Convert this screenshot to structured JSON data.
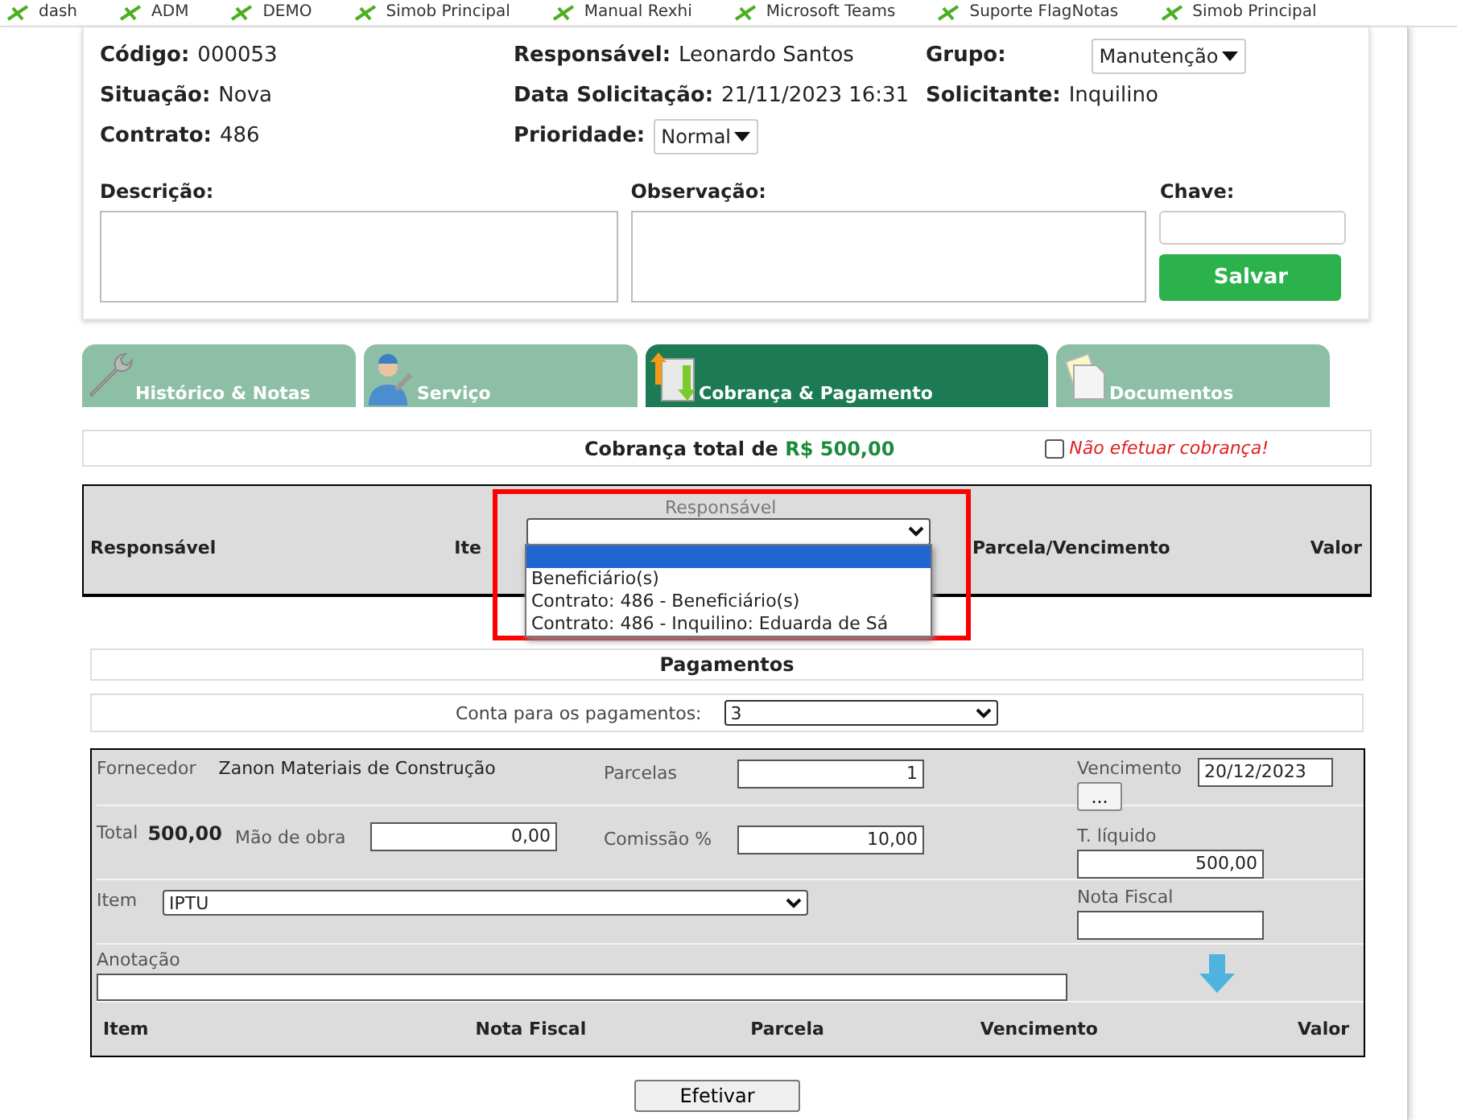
{
  "bookmarks": [
    {
      "label": "dash"
    },
    {
      "label": "ADM"
    },
    {
      "label": "DEMO"
    },
    {
      "label": "Simob Principal"
    },
    {
      "label": "Manual Rexhi"
    },
    {
      "label": "Microsoft Teams"
    },
    {
      "label": "Suporte FlagNotas"
    },
    {
      "label": "Simob Principal"
    }
  ],
  "info": [
    {
      "kind": "text",
      "label": "Código:",
      "value": "000053"
    },
    {
      "kind": "text",
      "label": "Responsável:",
      "value": "Leonardo Santos"
    },
    {
      "kind": "select",
      "label": "Grupo:",
      "value": "Manutenção"
    },
    {
      "kind": "text",
      "label": "Situação:",
      "value": "Nova"
    },
    {
      "kind": "text",
      "label": "Data Solicitação:",
      "value": "21/11/2023 16:31"
    },
    {
      "kind": "text",
      "label": "Solicitante:",
      "value": "Inquilino"
    },
    {
      "kind": "text",
      "label": "Contrato:",
      "value": "486"
    },
    {
      "kind": "select",
      "label": "Prioridade:",
      "value": "Normal"
    }
  ],
  "notes": {
    "description": "Descrição:",
    "observation": "Observação:",
    "key": "Chave:",
    "save": "Salvar"
  },
  "tabs": [
    {
      "label": "Histórico & Notas",
      "selected": false
    },
    {
      "label": "Serviço",
      "selected": false
    },
    {
      "label": "Cobrança & Pagamento",
      "selected": true
    },
    {
      "label": "Documentos",
      "selected": false
    }
  ],
  "charge": {
    "label": "Cobrança total de",
    "amount": "R$ 500,00",
    "no_charge": {
      "label": "Não efetuar cobrança!",
      "checked": false
    }
  },
  "responsible_table": {
    "columns": [
      "Responsável",
      "Ite",
      "Parcela/Vencimento",
      "Valor"
    ],
    "select": {
      "label": "Responsável",
      "expanded": true,
      "options": [
        {
          "selected": true
        },
        {
          "label": "Beneficiário(s)",
          "selected": false
        },
        {
          "label": "Contrato: 486 - Beneficiário(s)",
          "selected": false
        },
        {
          "label": "Contrato: 486 - Inquilino: Eduarda de Sá",
          "selected": false
        }
      ]
    }
  },
  "payments": {
    "title": "Pagamentos",
    "account_label": "Conta para os pagamentos:",
    "account_value": "3"
  },
  "form": {
    "supplier_label": "Fornecedor",
    "supplier": "Zanon Materiais de Construção",
    "installments_label": "Parcelas",
    "installments": "1",
    "due_label": "Vencimento",
    "due": "20/12/2023",
    "due_button": "...",
    "total_label": "Total",
    "total": "500,00",
    "labor_label": "Mão de obra",
    "labor": "0,00",
    "commission_label": "Comissão %",
    "commission": "10,00",
    "net_label": "T. líquido",
    "net": "500,00",
    "item_label": "Item",
    "item": "IPTU",
    "invoice_label": "Nota Fiscal",
    "note_label": "Anotação"
  },
  "items_table": {
    "columns": [
      "Item",
      "Nota Fiscal",
      "Parcela",
      "Vencimento",
      "Valor"
    ]
  },
  "submit": "Efetivar"
}
